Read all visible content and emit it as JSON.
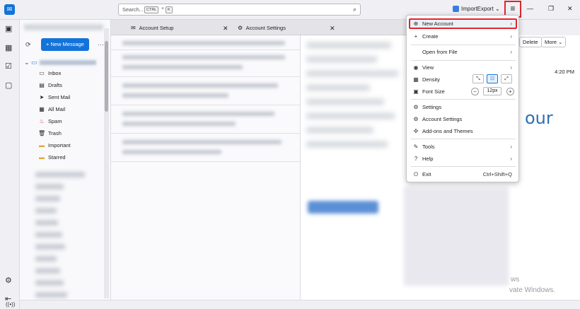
{
  "titlebar": {
    "search_placeholder": "Search...",
    "search_key1": "CTRL",
    "search_plus": "+",
    "search_key2": "K",
    "search_icon": "⌕",
    "importexport_label": "ImportExport",
    "importexport_chev": "⌄",
    "menu_icon": "≡",
    "minimize": "—",
    "maximize": "❐",
    "close": "✕"
  },
  "folderpane": {
    "new_message_label": "+  New Message",
    "more_icon": "···",
    "folders": [
      {
        "label": "Inbox",
        "icon": "▭"
      },
      {
        "label": "Drafts",
        "icon": "▤"
      },
      {
        "label": "Sent Mail",
        "icon": "➤"
      },
      {
        "label": "All Mail",
        "icon": "▦"
      },
      {
        "label": "Spam",
        "icon": "♨"
      },
      {
        "label": "Trash",
        "icon": "🗑"
      },
      {
        "label": "Important",
        "icon": "▬"
      },
      {
        "label": "Starred",
        "icon": "▬"
      }
    ]
  },
  "tabs": [
    {
      "label": "Account Setup",
      "icon": "✉",
      "close": "✕"
    },
    {
      "label": "Account Settings",
      "icon": "⚙",
      "close": "✕"
    }
  ],
  "reader": {
    "delete_label": "Delete",
    "more_label": "More ⌄",
    "time": "4:20 PM",
    "big_text": "our",
    "watermark_1": "ws",
    "watermark_2": "vate Windows."
  },
  "appmenu": {
    "items": [
      {
        "label": "New Account",
        "icon": "⊕",
        "chev": "›"
      },
      {
        "label": "Create",
        "icon": "+",
        "chev": "›"
      },
      {
        "label": "Open from File",
        "icon": "",
        "chev": "›"
      },
      {
        "label": "View",
        "icon": "◉",
        "chev": "›"
      },
      {
        "label": "Density",
        "icon": "▦"
      },
      {
        "label": "Font Size",
        "icon": "▣"
      },
      {
        "label": "Settings",
        "icon": "⚙"
      },
      {
        "label": "Account Settings",
        "icon": "⚙"
      },
      {
        "label": "Add-ons and Themes",
        "icon": "✣"
      },
      {
        "label": "Tools",
        "icon": "✎",
        "chev": "›"
      },
      {
        "label": "Help",
        "icon": "?",
        "chev": "›"
      },
      {
        "label": "Exit",
        "icon": "⏻",
        "shortcut": "Ctrl+Shift+Q"
      }
    ],
    "density_icons": [
      "⤡",
      "⊡",
      "⤢"
    ],
    "zoom_out": "−",
    "zoom_in": "+",
    "font_size_value": "12px"
  },
  "colors": {
    "accent": "#1373d9",
    "highlight": "#e0252e"
  }
}
